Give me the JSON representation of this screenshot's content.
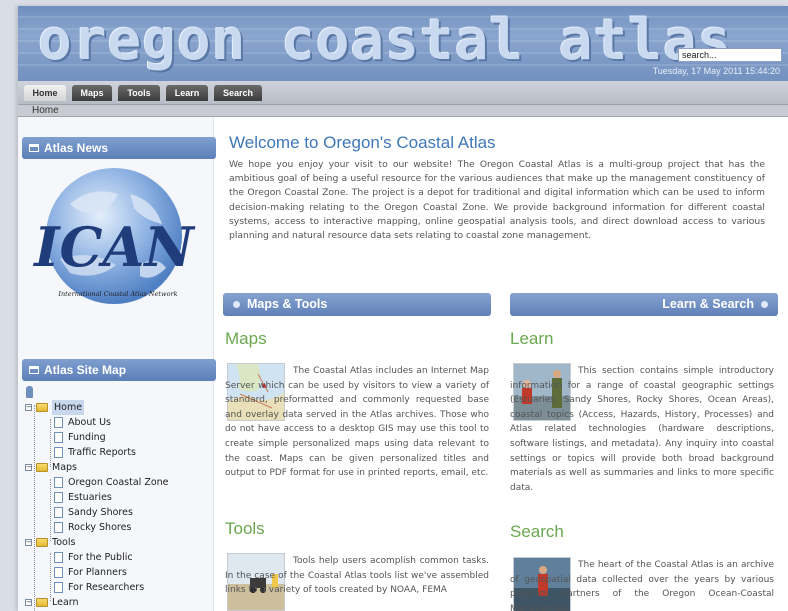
{
  "header": {
    "title": "oregon coastal atlas",
    "search_value": "search...",
    "datetime": "Tuesday, 17 May 2011 15:44:20"
  },
  "nav": {
    "tabs": [
      "Home",
      "Maps",
      "Tools",
      "Learn",
      "Search"
    ],
    "active": "Home"
  },
  "breadcrumb": "Home",
  "sidebar": {
    "news_title": "Atlas News",
    "logo_text": "ICAN",
    "logo_caption": "International Coastal Atlas Network",
    "sitemap_title": "Atlas Site Map",
    "tree": {
      "home": "Home",
      "about": "About Us",
      "funding": "Funding",
      "traffic": "Traffic Reports",
      "maps": "Maps",
      "ocz": "Oregon Coastal Zone",
      "estuaries": "Estuaries",
      "sandy": "Sandy Shores",
      "rocky": "Rocky Shores",
      "tools": "Tools",
      "public": "For the Public",
      "planners": "For Planners",
      "researchers": "For Researchers",
      "learn": "Learn"
    }
  },
  "main": {
    "welcome_title": "Welcome to Oregon's Coastal Atlas",
    "welcome_text": "We hope you enjoy your visit to our website! The Oregon Coastal Atlas is a multi-group project that has the ambitious goal of being a useful resource for the various audiences that make up the management constituency of the Oregon Coastal Zone. The project is a depot for traditional and digital information which can be used to inform decision-making relating to the Oregon Coastal Zone. We provide background information for different coastal systems, access to interactive mapping, online geospatial analysis tools, and direct download access to various planning and natural resource data sets relating to coastal zone management.",
    "left_bar": "Maps & Tools",
    "right_bar": "Learn & Search",
    "maps_title": "Maps",
    "maps_text": "The Coastal Atlas includes an Internet Map Server which can be used by visitors to view a variety of standard, preformatted and commonly requested base and overlay data served in the Atlas archives. Those who do not have access to a desktop GIS may use this tool to create simple personalized maps using data relevant to the coast. Maps can be given personalized titles and output to PDF format for use in printed reports, email, etc.",
    "tools_title": "Tools",
    "tools_text": "Tools help users acomplish common tasks. In the case of the Coastal Atlas tools list we've assembled links to a variety of tools created by NOAA, FEMA",
    "learn_title": "Learn",
    "learn_text": "This section contains simple introductory information for a range of coastal geographic settings (Estuaries, Sandy Shores, Rocky Shores, Ocean Areas), coastal topics (Access, Hazards, History, Processes) and Atlas related technologies (hardware descriptions, software listings, and metadata). Any inquiry into coastal settings or topics will provide both broad background materials as well as summaries and links to more specific data.",
    "search_title": "Search",
    "search_text": "The heart of the Coastal Atlas is an archive of geospatial data collected over the years by various program partners of the Oregon Ocean-Coastal Management"
  }
}
